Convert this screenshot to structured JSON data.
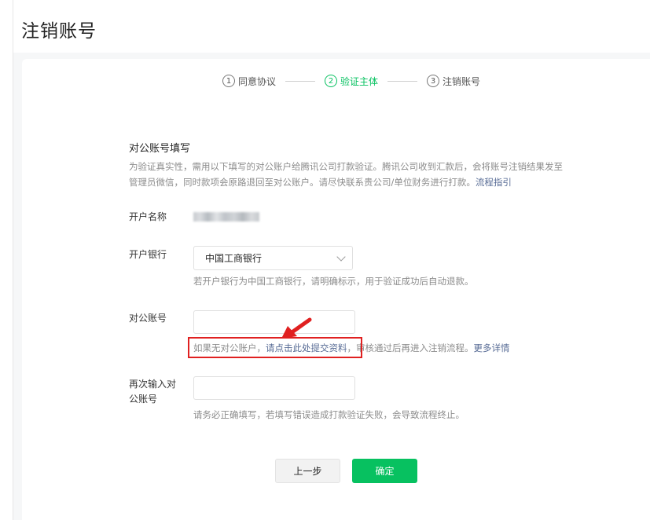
{
  "page": {
    "title": "注销账号"
  },
  "steps": [
    {
      "num": "1",
      "label": "同意协议"
    },
    {
      "num": "2",
      "label": "验证主体"
    },
    {
      "num": "3",
      "label": "注销账号"
    }
  ],
  "section": {
    "title": "对公账号填写",
    "desc": "为验证真实性，需用以下填写的对公账户给腾讯公司打款验证。腾讯公司收到汇款后，会将账号注销结果发至管理员微信，同时款项会原路退回至对公账户。请尽快联系贵公司/单位财务进行打款。",
    "desc_link": "流程指引"
  },
  "form": {
    "name_label": "开户名称",
    "bank_label": "开户银行",
    "bank_value": "中国工商银行",
    "bank_hint": "若开户银行为中国工商银行，请明确标示，用于验证成功后自动退款。",
    "account_label": "对公账号",
    "notice_prefix": "如果无对公账户，",
    "notice_link": "请点击此处提交资料",
    "notice_mid": "，审核通过后再进入注销流程。",
    "notice_more": "更多详情",
    "reaccount_label": "再次输入对公账号",
    "reaccount_hint": "请务必正确填写，若填写错误造成打款验证失败，会导致流程终止。"
  },
  "buttons": {
    "prev": "上一步",
    "confirm": "确定"
  },
  "colors": {
    "accent": "#07c160",
    "link": "#576b95",
    "highlight": "#e02020"
  }
}
